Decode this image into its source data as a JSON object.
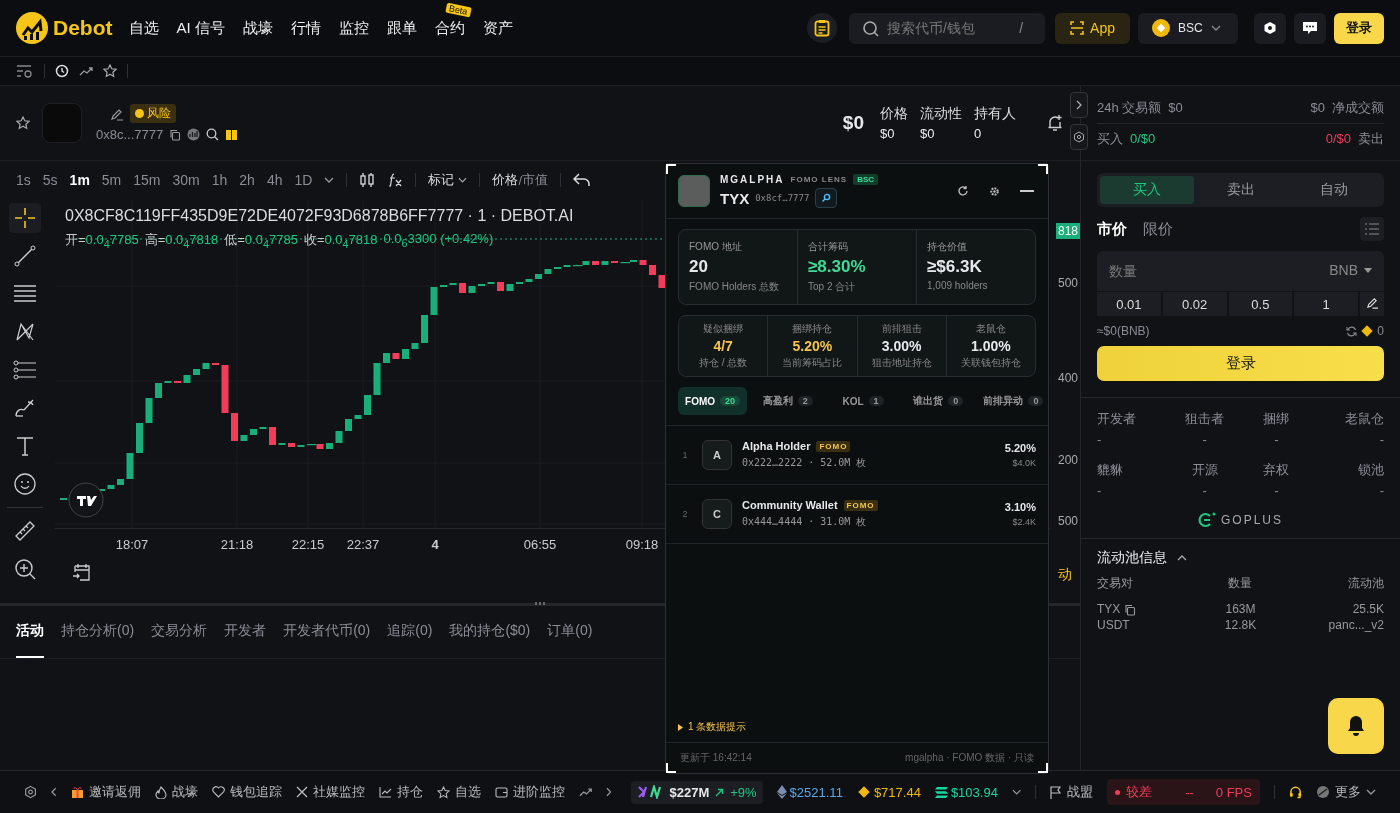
{
  "nav": {
    "logo": "Debot",
    "items": [
      {
        "label": "自选"
      },
      {
        "label": "AI 信号"
      },
      {
        "label": "战壕"
      },
      {
        "label": "行情"
      },
      {
        "label": "监控"
      },
      {
        "label": "跟单"
      },
      {
        "label": "合约",
        "badge": "Beta"
      },
      {
        "label": "资产"
      }
    ],
    "search": {
      "placeholder": "搜索代币/钱包",
      "shortcut": "/"
    },
    "app_button": "App",
    "chain": "BSC",
    "login": "登录"
  },
  "token": {
    "address": "0x8c...7777",
    "risk": "风险",
    "price": "$0",
    "stats": [
      {
        "label": "价格",
        "value": "$0"
      },
      {
        "label": "流动性",
        "value": "$0"
      },
      {
        "label": "持有人",
        "value": "0"
      }
    ]
  },
  "volume": {
    "label": "24h 交易额",
    "value": "$0",
    "net_value": "$0",
    "net_label": "净成交额",
    "buy_label": "买入",
    "buy_value": "0/$0",
    "sell_value": "0/$0",
    "sell_label": "卖出"
  },
  "chart": {
    "intervals": [
      {
        "label": "1s",
        "selected": false
      },
      {
        "label": "5s",
        "selected": false
      },
      {
        "label": "1m",
        "selected": true
      },
      {
        "label": "5m",
        "selected": false
      },
      {
        "label": "15m",
        "selected": false
      },
      {
        "label": "30m",
        "selected": false
      },
      {
        "label": "1h",
        "selected": false
      },
      {
        "label": "2h",
        "selected": false
      },
      {
        "label": "4h",
        "selected": false
      },
      {
        "label": "1D",
        "selected": false
      }
    ],
    "mark_menu": "标记",
    "price_modes": [
      {
        "label": "价格",
        "selected": true
      },
      {
        "label": "市值",
        "selected": false
      }
    ],
    "mode_separator": "/",
    "title": "0X8CF8C119FF435D9E72DE4072F93D6878B6FF7777 · 1 · DEBOT.AI",
    "ohlc": [
      {
        "label": "开=",
        "value": "0.0$_{4}$7785"
      },
      {
        "label": "高=",
        "value": "0.0$_{4}$7818"
      },
      {
        "label": "低=",
        "value": "0.0$_{4}$7785"
      },
      {
        "label": "收=",
        "value": "0.0$_{4}$7818"
      }
    ],
    "change": "0.0$_{6}$3300 (+0.42%)",
    "x_labels": [
      {
        "label": "18:07",
        "bold": false
      },
      {
        "label": "21:18",
        "bold": false
      },
      {
        "label": "22:15",
        "bold": false
      },
      {
        "label": "22:37",
        "bold": false
      },
      {
        "label": "4",
        "bold": true
      },
      {
        "label": "06:55",
        "bold": false
      },
      {
        "label": "09:18",
        "bold": false
      }
    ],
    "price_tag": "818",
    "y_labels": [
      "500",
      "400",
      "200",
      "500"
    ],
    "cut_label": "动"
  },
  "bottom_tabs": [
    {
      "label": "活动",
      "selected": true
    },
    {
      "label": "持仓分析(0)",
      "selected": false
    },
    {
      "label": "交易分析",
      "selected": false
    },
    {
      "label": "开发者",
      "selected": false
    },
    {
      "label": "开发者代币(0)",
      "selected": false
    },
    {
      "label": "追踪(0)",
      "selected": false
    },
    {
      "label": "我的持仓($0)",
      "selected": false
    },
    {
      "label": "订单(0)",
      "selected": false
    }
  ],
  "popup": {
    "brand": "MGALPHA",
    "subtitle": "FOMO LENS",
    "chain": "BSC",
    "symbol": "TYX",
    "address": "0x8cf…7777",
    "summary": [
      {
        "label": "FOMO 地址",
        "value": "20",
        "note": "FOMO Holders 总数",
        "highlight": false
      },
      {
        "label": "合计筹码",
        "value": "≥8.30%",
        "note": "Top 2 合计",
        "highlight": true
      },
      {
        "label": "持仓价值",
        "value": "≥$6.3K",
        "note": "1,009 holders",
        "highlight": false
      }
    ],
    "metrics": [
      {
        "label": "疑似捆绑",
        "value": "4/7",
        "note": "持仓 / 总数",
        "highlight": true
      },
      {
        "label": "捆绑持仓",
        "value": "5.20%",
        "note": "当前筹码占比",
        "highlight": true
      },
      {
        "label": "前排狙击",
        "value": "3.00%",
        "note": "狙击地址持仓",
        "highlight": false
      },
      {
        "label": "老鼠仓",
        "value": "1.00%",
        "note": "关联钱包持仓",
        "highlight": false
      }
    ],
    "tabs": [
      {
        "label": "FOMO",
        "count": "20",
        "selected": true
      },
      {
        "label": "高盈利",
        "count": "2",
        "selected": false
      },
      {
        "label": "KOL",
        "count": "1",
        "selected": false
      },
      {
        "label": "谁出货",
        "count": "0",
        "selected": false
      },
      {
        "label": "前排异动",
        "count": "0",
        "selected": false
      }
    ],
    "holders": [
      {
        "rank": "1",
        "initial": "A",
        "name": "Alpha Holder",
        "tag": "FOMO",
        "detail": "0x222…2222 · 52.0M 枚",
        "share": "5.20%",
        "value": "$4.0K"
      },
      {
        "rank": "2",
        "initial": "C",
        "name": "Community Wallet",
        "tag": "FOMO",
        "detail": "0x444…4444 · 31.0M 枚",
        "share": "3.10%",
        "value": "$2.4K"
      }
    ],
    "hint": "1 条数据提示",
    "updated": "更新于 16:42:14",
    "footer": "mgalpha · FOMO 数据 · 只读"
  },
  "trade": {
    "tabs": [
      {
        "label": "买入",
        "selected": true
      },
      {
        "label": "卖出",
        "selected": false
      },
      {
        "label": "自动",
        "selected": false
      }
    ],
    "order_types": [
      {
        "label": "市价",
        "selected": true
      },
      {
        "label": "限价",
        "selected": false
      }
    ],
    "amount": {
      "placeholder": "数量",
      "currency": "BNB"
    },
    "presets": [
      "0.01",
      "0.02",
      "0.5",
      "1"
    ],
    "approx": "≈$0(BNB)",
    "balance": "0",
    "login": "登录"
  },
  "security": [
    {
      "label": "开发者",
      "value": "-"
    },
    {
      "label": "狙击者",
      "value": "-"
    },
    {
      "label": "捆绑",
      "value": "-"
    },
    {
      "label": "老鼠仓",
      "value": "-"
    },
    {
      "label": "貔貅",
      "value": "-"
    },
    {
      "label": "开源",
      "value": "-"
    },
    {
      "label": "弃权",
      "value": "-"
    },
    {
      "label": "锁池",
      "value": "-"
    }
  ],
  "goplus": "GOPLUS",
  "pool": {
    "title": "流动池信息",
    "columns": [
      "交易对",
      "数量",
      "流动池"
    ],
    "rows": [
      [
        "TYX",
        "163M",
        "25.5K"
      ],
      [
        "USDT",
        "12.8K",
        "panc..._v2"
      ]
    ]
  },
  "status_bar": {
    "links": [
      {
        "kind": "gift",
        "label": "邀请返佣"
      },
      {
        "kind": "fire",
        "label": "战壕"
      },
      {
        "kind": "heart",
        "label": "钱包追踪"
      },
      {
        "kind": "x",
        "label": "社媒监控"
      },
      {
        "kind": "chart",
        "label": "持仓"
      },
      {
        "kind": "star",
        "label": "自选"
      },
      {
        "kind": "wallet",
        "label": "进阶监控"
      }
    ],
    "market_cap": "$227M",
    "market_change": "+9%",
    "prices": [
      {
        "kind": "eth",
        "value": "$2521.11",
        "color": "#5aa9e6"
      },
      {
        "kind": "bnb",
        "value": "$717.44",
        "color": "#f0b90b"
      },
      {
        "kind": "sol",
        "value": "$103.94",
        "color": "#14d9a0"
      }
    ],
    "alliance": "战盟",
    "network": "较差",
    "latency": "--",
    "fps": "0 FPS",
    "more": "更多"
  }
}
